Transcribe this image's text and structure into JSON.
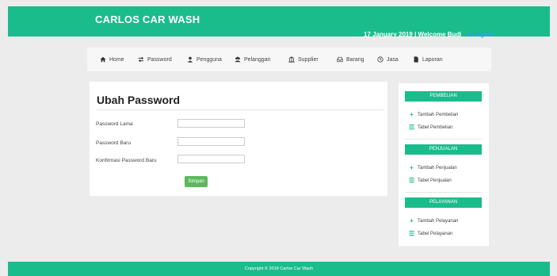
{
  "header": {
    "brand": "CARLOS CAR WASH",
    "date": "17 January 2019",
    "separator": "|",
    "welcome": "Welcome Budi",
    "logout": "Logout"
  },
  "nav": {
    "items": [
      {
        "label": "Home",
        "icon": "home-icon"
      },
      {
        "label": "Password",
        "icon": "exchange-icon"
      },
      {
        "label": "Pengguna",
        "icon": "user-icon"
      },
      {
        "label": "Pelanggan",
        "icon": "users-icon"
      },
      {
        "label": "Supplier",
        "icon": "bank-icon"
      },
      {
        "label": "Barang",
        "icon": "inbox-icon"
      },
      {
        "label": "Jasa",
        "icon": "clock-icon"
      },
      {
        "label": "Laporan",
        "icon": "file-icon"
      }
    ]
  },
  "form": {
    "title": "Ubah Password",
    "fields": [
      {
        "label": "Password Lama",
        "value": ""
      },
      {
        "label": "Password Baru",
        "value": ""
      },
      {
        "label": "Konfirmasi Password Baru",
        "value": ""
      }
    ],
    "submit": "Simpan"
  },
  "sidebar": {
    "sections": [
      {
        "heading": "PEMBELIAN",
        "items": [
          "Tambah Pembelian",
          "Tabel Pembelian"
        ]
      },
      {
        "heading": "PENJUALAN",
        "items": [
          "Tambah Penjualan",
          "Tabel Penjualan"
        ]
      },
      {
        "heading": "PELAYANAN",
        "items": [
          "Tambah Pelayanan",
          "Tabel Pelayanan"
        ]
      }
    ]
  },
  "footer": {
    "copyright": "Copyright © 2018 Carlos Car Wash"
  },
  "colors": {
    "accent": "#1abc8c",
    "button": "#5cb85c",
    "link": "#2ea3f2"
  }
}
